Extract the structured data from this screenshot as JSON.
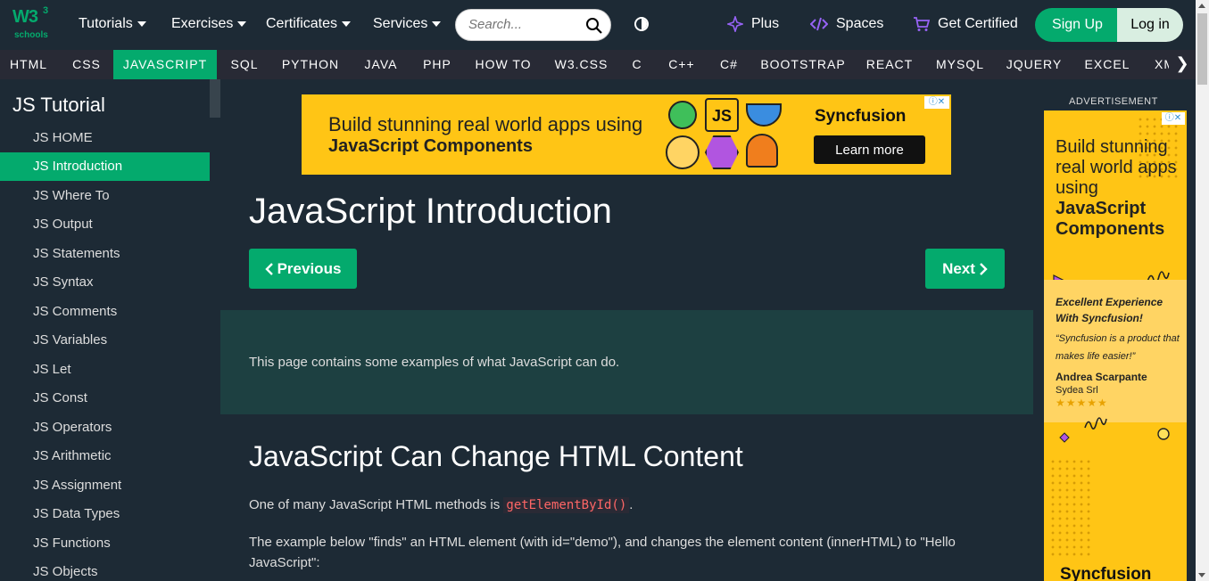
{
  "topnav": {
    "logo": {
      "w3": "W3",
      "sup": "3",
      "schools": "schools"
    },
    "menus": [
      "Tutorials",
      "Exercises",
      "Certificates",
      "Services"
    ],
    "search_placeholder": "Search...",
    "plus": "Plus",
    "spaces": "Spaces",
    "get_certified": "Get Certified",
    "sign_up": "Sign Up",
    "log_in": "Log in"
  },
  "subnav": {
    "items": [
      "HTML",
      "CSS",
      "JAVASCRIPT",
      "SQL",
      "PYTHON",
      "JAVA",
      "PHP",
      "HOW TO",
      "W3.CSS",
      "C",
      "C++",
      "C#",
      "BOOTSTRAP",
      "REACT",
      "MYSQL",
      "JQUERY",
      "EXCEL",
      "XML"
    ],
    "active": "JAVASCRIPT",
    "arrow": "❯"
  },
  "sidebar": {
    "title": "JS Tutorial",
    "items": [
      "JS HOME",
      "JS Introduction",
      "JS Where To",
      "JS Output",
      "JS Statements",
      "JS Syntax",
      "JS Comments",
      "JS Variables",
      "JS Let",
      "JS Const",
      "JS Operators",
      "JS Arithmetic",
      "JS Assignment",
      "JS Data Types",
      "JS Functions",
      "JS Objects"
    ],
    "active": "JS Introduction"
  },
  "banner_ad": {
    "line1": "Build stunning real world apps using",
    "line2": "JavaScript Components",
    "js_tile": "JS",
    "brand": "Syncfusion",
    "cta": "Learn more",
    "badge": "ⓘ✕"
  },
  "main": {
    "title": "JavaScript Introduction",
    "prev": "Previous",
    "next": "Next",
    "intro": "This page contains some examples of what JavaScript can do.",
    "section_title": "JavaScript Can Change HTML Content",
    "p1_before": "One of many JavaScript HTML methods is",
    "p1_code": "getElementById()",
    "p1_after": ".",
    "p2": "The example below \"finds\" an HTML element (with id=\"demo\"), and changes the element content (innerHTML) to \"Hello JavaScript\":"
  },
  "right_ad": {
    "label": "ADVERTISEMENT",
    "headline1": "Build stunning real world apps using",
    "headline2": "JavaScript Components",
    "quote_title": "Excellent Experience With Syncfusion!",
    "quote_text": "“Syncfusion is a product that makes life easier!”",
    "author": "Andrea Scarpante",
    "company": "Sydea Srl",
    "stars": "★★★★★",
    "brand": "Syncfusion",
    "badge": "ⓘ✕"
  },
  "colors": {
    "accent": "#04aa6d",
    "bg": "#1d2a35",
    "subnav": "#282a35",
    "ad_yellow": "#ffc515",
    "intro_bg": "#1d4041"
  }
}
